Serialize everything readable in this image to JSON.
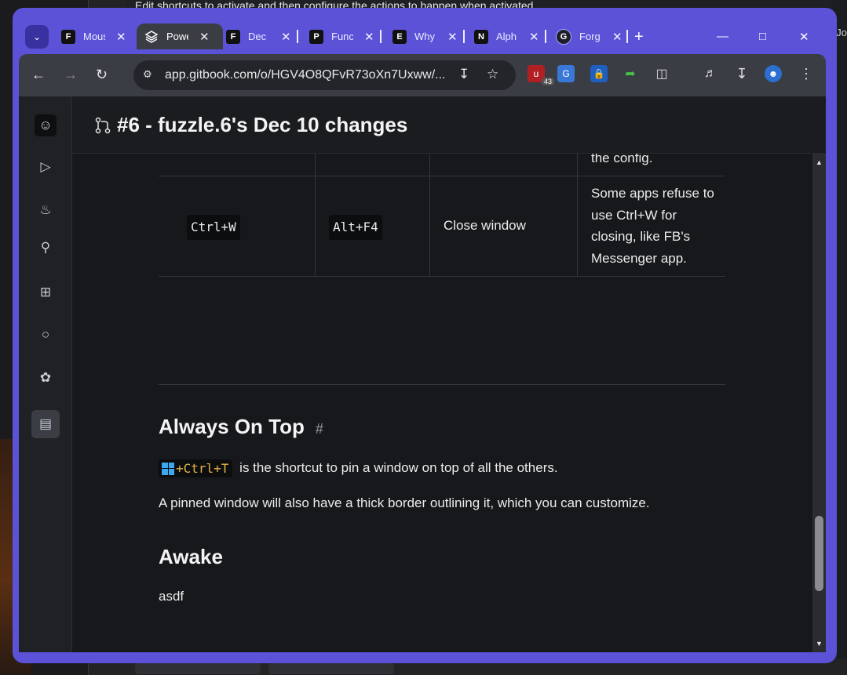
{
  "desktop": {
    "top_text": "Edit shortcuts to activate and then configure the actions to happen when activated",
    "right_text": "Jo"
  },
  "tabs": [
    {
      "favicon": "F",
      "title": "Mouse",
      "active": false
    },
    {
      "favicon": "layers-icon",
      "title": "Power",
      "active": true
    },
    {
      "favicon": "F",
      "title": "Dec",
      "active": false
    },
    {
      "favicon": "P",
      "title": "Func",
      "active": false
    },
    {
      "favicon": "E",
      "title": "Why",
      "active": false
    },
    {
      "favicon": "N",
      "title": "Alph",
      "active": false
    },
    {
      "favicon": "G",
      "title": "Forg",
      "active": false
    }
  ],
  "toolbar": {
    "url": "app.gitbook.com/o/HGV4O8QFvR73oXn7Uxww/...",
    "ext_badge": "43"
  },
  "header": {
    "title": "#6 - fuzzle.6's Dec 10 changes"
  },
  "table": {
    "top_fragment": "the config.",
    "row": {
      "default": "Ctrl+W",
      "replacement": "Alt+F4",
      "action": "Close window",
      "note": "Some apps refuse to use Ctrl+W for closing, like FB's Messenger app."
    }
  },
  "section_always_on_top": {
    "heading": "Always On Top",
    "anchor": "#",
    "shortcut": "+Ctrl+T",
    "line1": "is the shortcut to pin a window on top of all the others.",
    "line2": "A pinned window will also have a thick border outlining it, which you can customize."
  },
  "section_awake": {
    "heading": "Awake",
    "body": "asdf"
  },
  "colors": {
    "window_frame": "#5b52d8",
    "page_bg": "#17181b",
    "shortcut_text": "#e3b341",
    "win_logo": "#3ea8ee"
  }
}
